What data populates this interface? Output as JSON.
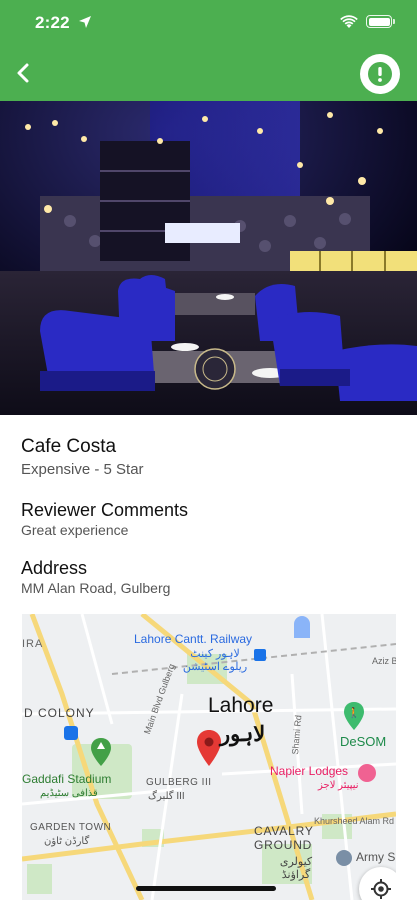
{
  "status_bar": {
    "time": "2:22"
  },
  "colors": {
    "header_green": "#4caf50",
    "map_pin": "#e53935",
    "park_green": "#43a047"
  },
  "place": {
    "name": "Cafe Costa",
    "subtitle": "Expensive - 5 Star"
  },
  "comments": {
    "title": "Reviewer Comments",
    "value": "Great experience"
  },
  "address": {
    "title": "Address",
    "value": "MM Alan Road, Gulberg"
  },
  "map": {
    "labels": {
      "railway": "Lahore Cantt. Railway",
      "railway_urdu": "لاہور کینٹ ریلوے اسٹیشن",
      "city": "Lahore",
      "city_urdu": "لاہور",
      "colony": "D COLONY",
      "stadium": "Gaddafi Stadium",
      "stadium_urdu": "قذافی سٹیڈیم",
      "gulberg": "GULBERG III",
      "gulberg_urdu": "گلبرگ III",
      "garden_town": "GARDEN TOWN",
      "garden_town_urdu": "گارڈن ٹاؤن",
      "cavalry": "CAVALRY GROUND",
      "cavalry_urdu": "کیولری گراؤنڈ",
      "napier": "Napier Lodges",
      "napier_urdu": "نیپیئر لاجز",
      "desom": "DeSOM",
      "army": "Army S",
      "main_blvd": "Main Blvd Gulberg",
      "shami": "Shami Rd",
      "khursheed": "Khursheed Alam Rd",
      "aziz": "Aziz Bh",
      "ira": "IRA"
    }
  }
}
